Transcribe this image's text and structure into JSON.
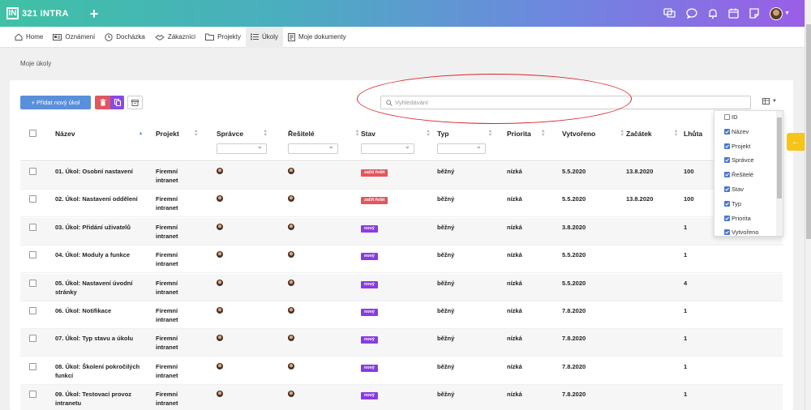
{
  "app": {
    "logo_mark": "IN",
    "name": "321 INTRA",
    "plus": "+"
  },
  "nav": [
    {
      "label": "Home",
      "icon": "home-icon"
    },
    {
      "label": "Oznámení",
      "icon": "announcement-icon"
    },
    {
      "label": "Docházka",
      "icon": "clock-icon"
    },
    {
      "label": "Zákazníci",
      "icon": "handshake-icon"
    },
    {
      "label": "Projekty",
      "icon": "folder-icon"
    },
    {
      "label": "Úkoly",
      "icon": "tasks-icon",
      "active": true
    },
    {
      "label": "Moje dokumenty",
      "icon": "document-icon"
    }
  ],
  "breadcrumb": "Moje úkoly",
  "toolbar": {
    "add_label": "+ Přidat nový úkol"
  },
  "search": {
    "placeholder": "Vyhledávání"
  },
  "table": {
    "headers": [
      "Název",
      "Projekt",
      "Správce",
      "Řešitelé",
      "Stav",
      "Typ",
      "Priorita",
      "Vytvořeno",
      "Začátek",
      "Lhůta"
    ],
    "rows": [
      {
        "name": [
          "01. Úkol: Osobní nastavení",
          ""
        ],
        "project": [
          "Firemní",
          "intranet"
        ],
        "status": "začít řešit",
        "status_color": "red",
        "type": "běžný",
        "priority": "nízká",
        "created": "5.5.2020",
        "start": "13.8.2020",
        "deadline": "100"
      },
      {
        "name": [
          "02. Úkol: Nastavení oddělení",
          ""
        ],
        "project": [
          "Firemní",
          "intranet"
        ],
        "status": "začít řešit",
        "status_color": "red",
        "type": "běžný",
        "priority": "nízká",
        "created": "5.5.2020",
        "start": "13.8.2020",
        "deadline": "100"
      },
      {
        "name": [
          "03. Úkol: Přidání uživatelů",
          ""
        ],
        "project": [
          "Firemní",
          "intranet"
        ],
        "status": "nový",
        "status_color": "purple",
        "type": "běžný",
        "priority": "nízká",
        "created": "3.8.2020",
        "start": "",
        "deadline": "1"
      },
      {
        "name": [
          "04. Úkol: Moduly a funkce",
          ""
        ],
        "project": [
          "Firemní",
          "intranet"
        ],
        "status": "nový",
        "status_color": "purple",
        "type": "běžný",
        "priority": "nízká",
        "created": "5.5.2020",
        "start": "",
        "deadline": "1"
      },
      {
        "name": [
          "05. Úkol: Nastavení úvodní",
          "stránky"
        ],
        "project": [
          "Firemní",
          "intranet"
        ],
        "status": "nový",
        "status_color": "purple",
        "type": "běžný",
        "priority": "nízká",
        "created": "5.5.2020",
        "start": "",
        "deadline": "4"
      },
      {
        "name": [
          "06. Úkol: Notifikace",
          ""
        ],
        "project": [
          "Firemní",
          "intranet"
        ],
        "status": "nový",
        "status_color": "purple",
        "type": "běžný",
        "priority": "nízká",
        "created": "7.8.2020",
        "start": "",
        "deadline": "1"
      },
      {
        "name": [
          "07. Úkol: Typ stavu a úkolu",
          ""
        ],
        "project": [
          "Firemní",
          "intranet"
        ],
        "status": "nový",
        "status_color": "purple",
        "type": "běžný",
        "priority": "nízká",
        "created": "7.8.2020",
        "start": "",
        "deadline": "1"
      },
      {
        "name": [
          "08. Úkol: Školení pokročilých",
          "funkcí"
        ],
        "project": [
          "Firemní",
          "intranet"
        ],
        "status": "nový",
        "status_color": "purple",
        "type": "běžný",
        "priority": "nízká",
        "created": "7.8.2020",
        "start": "",
        "deadline": "1"
      },
      {
        "name": [
          "09. Úkol: Testovací provoz",
          "intranetu"
        ],
        "project": [
          "Firemní",
          "intranet"
        ],
        "status": "nový",
        "status_color": "purple",
        "type": "běžný",
        "priority": "nízká",
        "created": "7.8.2020",
        "start": "",
        "deadline": "1"
      }
    ]
  },
  "column_picker": [
    {
      "label": "ID",
      "checked": false
    },
    {
      "label": "Název",
      "checked": true
    },
    {
      "label": "Projekt",
      "checked": true
    },
    {
      "label": "Správce",
      "checked": true
    },
    {
      "label": "Řešitelé",
      "checked": true
    },
    {
      "label": "Stav",
      "checked": true
    },
    {
      "label": "Typ",
      "checked": true
    },
    {
      "label": "Priorita",
      "checked": true
    },
    {
      "label": "Vytvořeno",
      "checked": true
    }
  ],
  "colors": {
    "accent": "#5a8fdb",
    "danger": "#e0575e",
    "purple": "#8a3be0",
    "highlight": "#d9232a",
    "sidetab": "#f5c518"
  }
}
